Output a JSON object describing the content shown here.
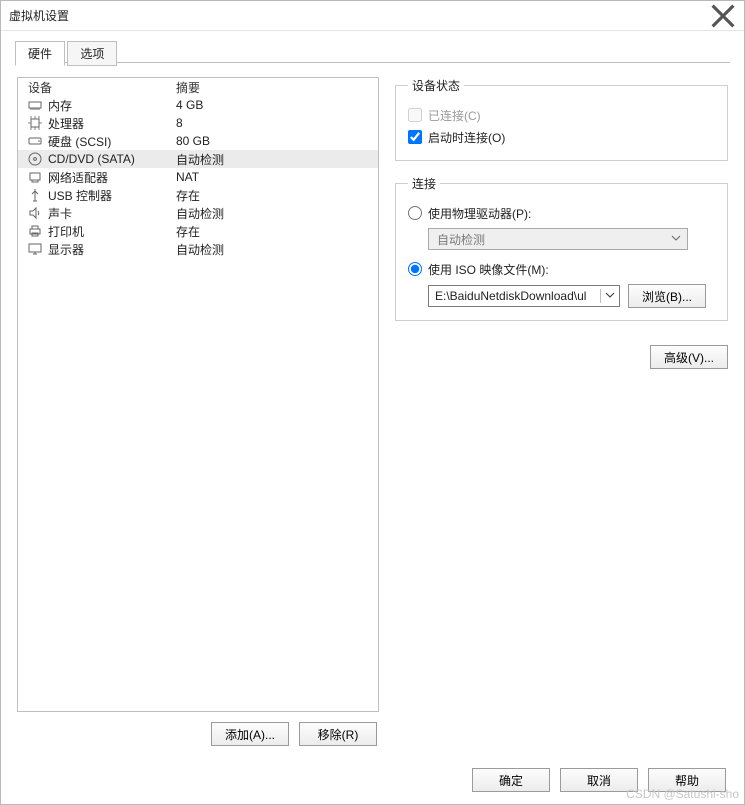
{
  "window": {
    "title": "虚拟机设置"
  },
  "tabs": [
    "硬件",
    "选项"
  ],
  "list": {
    "header": {
      "device": "设备",
      "summary": "摘要"
    },
    "rows": [
      {
        "device": "内存",
        "summary": "4 GB"
      },
      {
        "device": "处理器",
        "summary": "8"
      },
      {
        "device": "硬盘 (SCSI)",
        "summary": "80 GB"
      },
      {
        "device": "CD/DVD (SATA)",
        "summary": "自动检测"
      },
      {
        "device": "网络适配器",
        "summary": "NAT"
      },
      {
        "device": "USB 控制器",
        "summary": "存在"
      },
      {
        "device": "声卡",
        "summary": "自动检测"
      },
      {
        "device": "打印机",
        "summary": "存在"
      },
      {
        "device": "显示器",
        "summary": "自动检测"
      }
    ]
  },
  "status": {
    "title": "设备状态",
    "connected": "已连接(C)",
    "connect_on_power": "启动时连接(O)"
  },
  "connection": {
    "title": "连接",
    "physical": "使用物理驱动器(P):",
    "physical_value": "自动检测",
    "iso": "使用 ISO 映像文件(M):",
    "iso_path": "E:\\BaiduNetdiskDownload\\ul"
  },
  "buttons": {
    "add": "添加(A)...",
    "remove": "移除(R)",
    "browse": "浏览(B)...",
    "advanced": "高级(V)...",
    "ok": "确定",
    "cancel": "取消",
    "help": "帮助"
  },
  "watermark": "CSDN @Satushi-sho"
}
